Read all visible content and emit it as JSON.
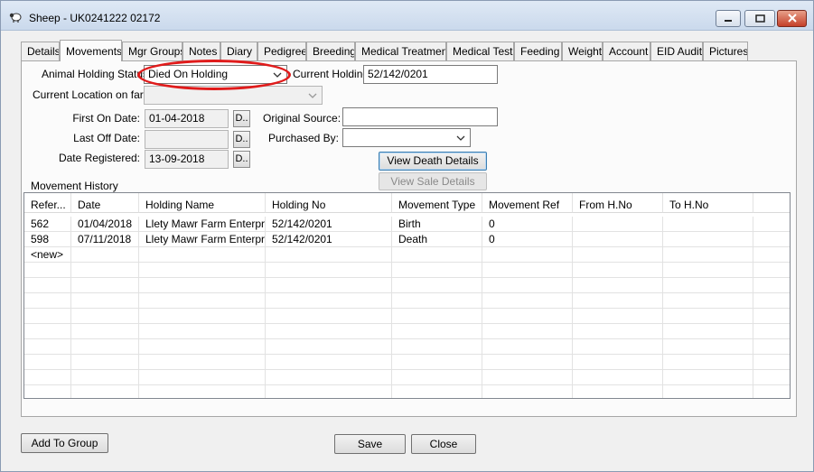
{
  "window": {
    "title": "Sheep - UK0241222 02172",
    "icon": "sheep-icon",
    "controls": {
      "minimize": "minimize-icon",
      "maximize": "maximize-icon",
      "close": "close-icon"
    }
  },
  "tabs": [
    {
      "label": "Details",
      "active": false
    },
    {
      "label": "Movements",
      "active": true
    },
    {
      "label": "Mgr Groups",
      "active": false
    },
    {
      "label": "Notes",
      "active": false
    },
    {
      "label": "Diary",
      "active": false
    },
    {
      "label": "Pedigree",
      "active": false
    },
    {
      "label": "Breeding",
      "active": false
    },
    {
      "label": "Medical Treatment",
      "active": false
    },
    {
      "label": "Medical Tests",
      "active": false
    },
    {
      "label": "Feeding",
      "active": false
    },
    {
      "label": "Weight",
      "active": false
    },
    {
      "label": "Account",
      "active": false
    },
    {
      "label": "EID Audit",
      "active": false
    },
    {
      "label": "Pictures",
      "active": false
    }
  ],
  "form": {
    "holding_status_label": "Animal Holding Status:",
    "holding_status_value": "Died On Holding",
    "current_holding_label": "Current Holding:",
    "current_holding_value": "52/142/0201",
    "current_location_label": "Current Location on farm:",
    "current_location_value": "",
    "first_on_label": "First On Date:",
    "first_on_value": "01-04-2018",
    "last_off_label": "Last Off Date:",
    "last_off_value": "",
    "date_registered_label": "Date Registered:",
    "date_registered_value": "13-09-2018",
    "date_button_label": "D..",
    "original_source_label": "Original Source:",
    "original_source_value": "",
    "purchased_by_label": "Purchased By:",
    "purchased_by_value": "",
    "view_death_label": "View Death Details",
    "view_sale_label": "View Sale Details"
  },
  "movement_history": {
    "title": "Movement History",
    "columns": [
      "Refer...",
      "Date",
      "Holding Name",
      "Holding No",
      "Movement Type",
      "Movement Ref",
      "From H.No",
      "To H.No"
    ],
    "rows": [
      [
        "562",
        "01/04/2018",
        "Llety Mawr Farm Enterpri",
        "52/142/0201",
        "Birth",
        "0",
        "",
        ""
      ],
      [
        "598",
        "07/11/2018",
        "Llety Mawr Farm Enterpri",
        "52/142/0201",
        "Death",
        "0",
        "",
        ""
      ],
      [
        "<new>",
        "",
        "",
        "",
        "",
        "",
        "",
        ""
      ]
    ]
  },
  "footer": {
    "add_to_group_label": "Add To Group",
    "save_label": "Save",
    "close_label": "Close"
  },
  "colors": {
    "highlight_ring": "#e01b1b",
    "window_border": "#8a9bb3",
    "panel_bg": "#fbfbfb"
  }
}
